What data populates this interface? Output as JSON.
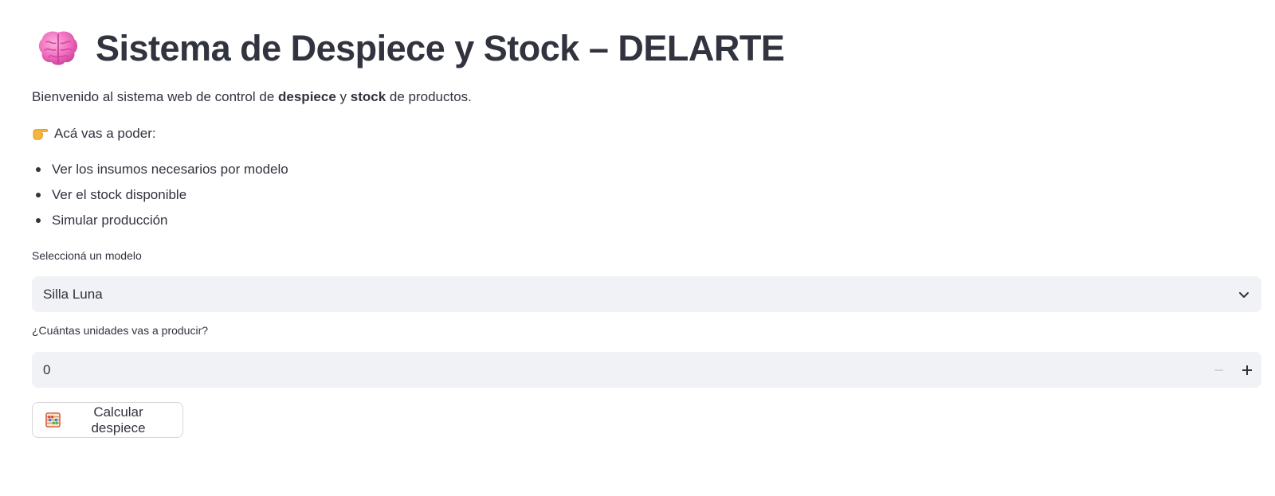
{
  "header": {
    "title": "Sistema de Despiece y Stock – DELARTE",
    "title_icon": "brain-icon"
  },
  "intro": {
    "prefix": "Bienvenido al sistema web de control de ",
    "bold1": "despiece",
    "middle": " y ",
    "bold2": "stock",
    "suffix": " de productos."
  },
  "capabilities": {
    "heading": "Acá vas a poder:",
    "heading_icon": "pointing-hand-icon",
    "items": [
      "Ver los insumos necesarios por modelo",
      "Ver el stock disponible",
      "Simular producción"
    ]
  },
  "model_select": {
    "label": "Seleccioná un modelo",
    "value": "Silla Luna"
  },
  "quantity": {
    "label": "¿Cuántas unidades vas a producir?",
    "value": "0"
  },
  "calc_button": {
    "label": "Calcular despiece",
    "icon": "abacus-icon"
  },
  "colors": {
    "text": "#31333f",
    "input_bg": "#f0f2f6",
    "brain_pink": "#f472c4"
  }
}
